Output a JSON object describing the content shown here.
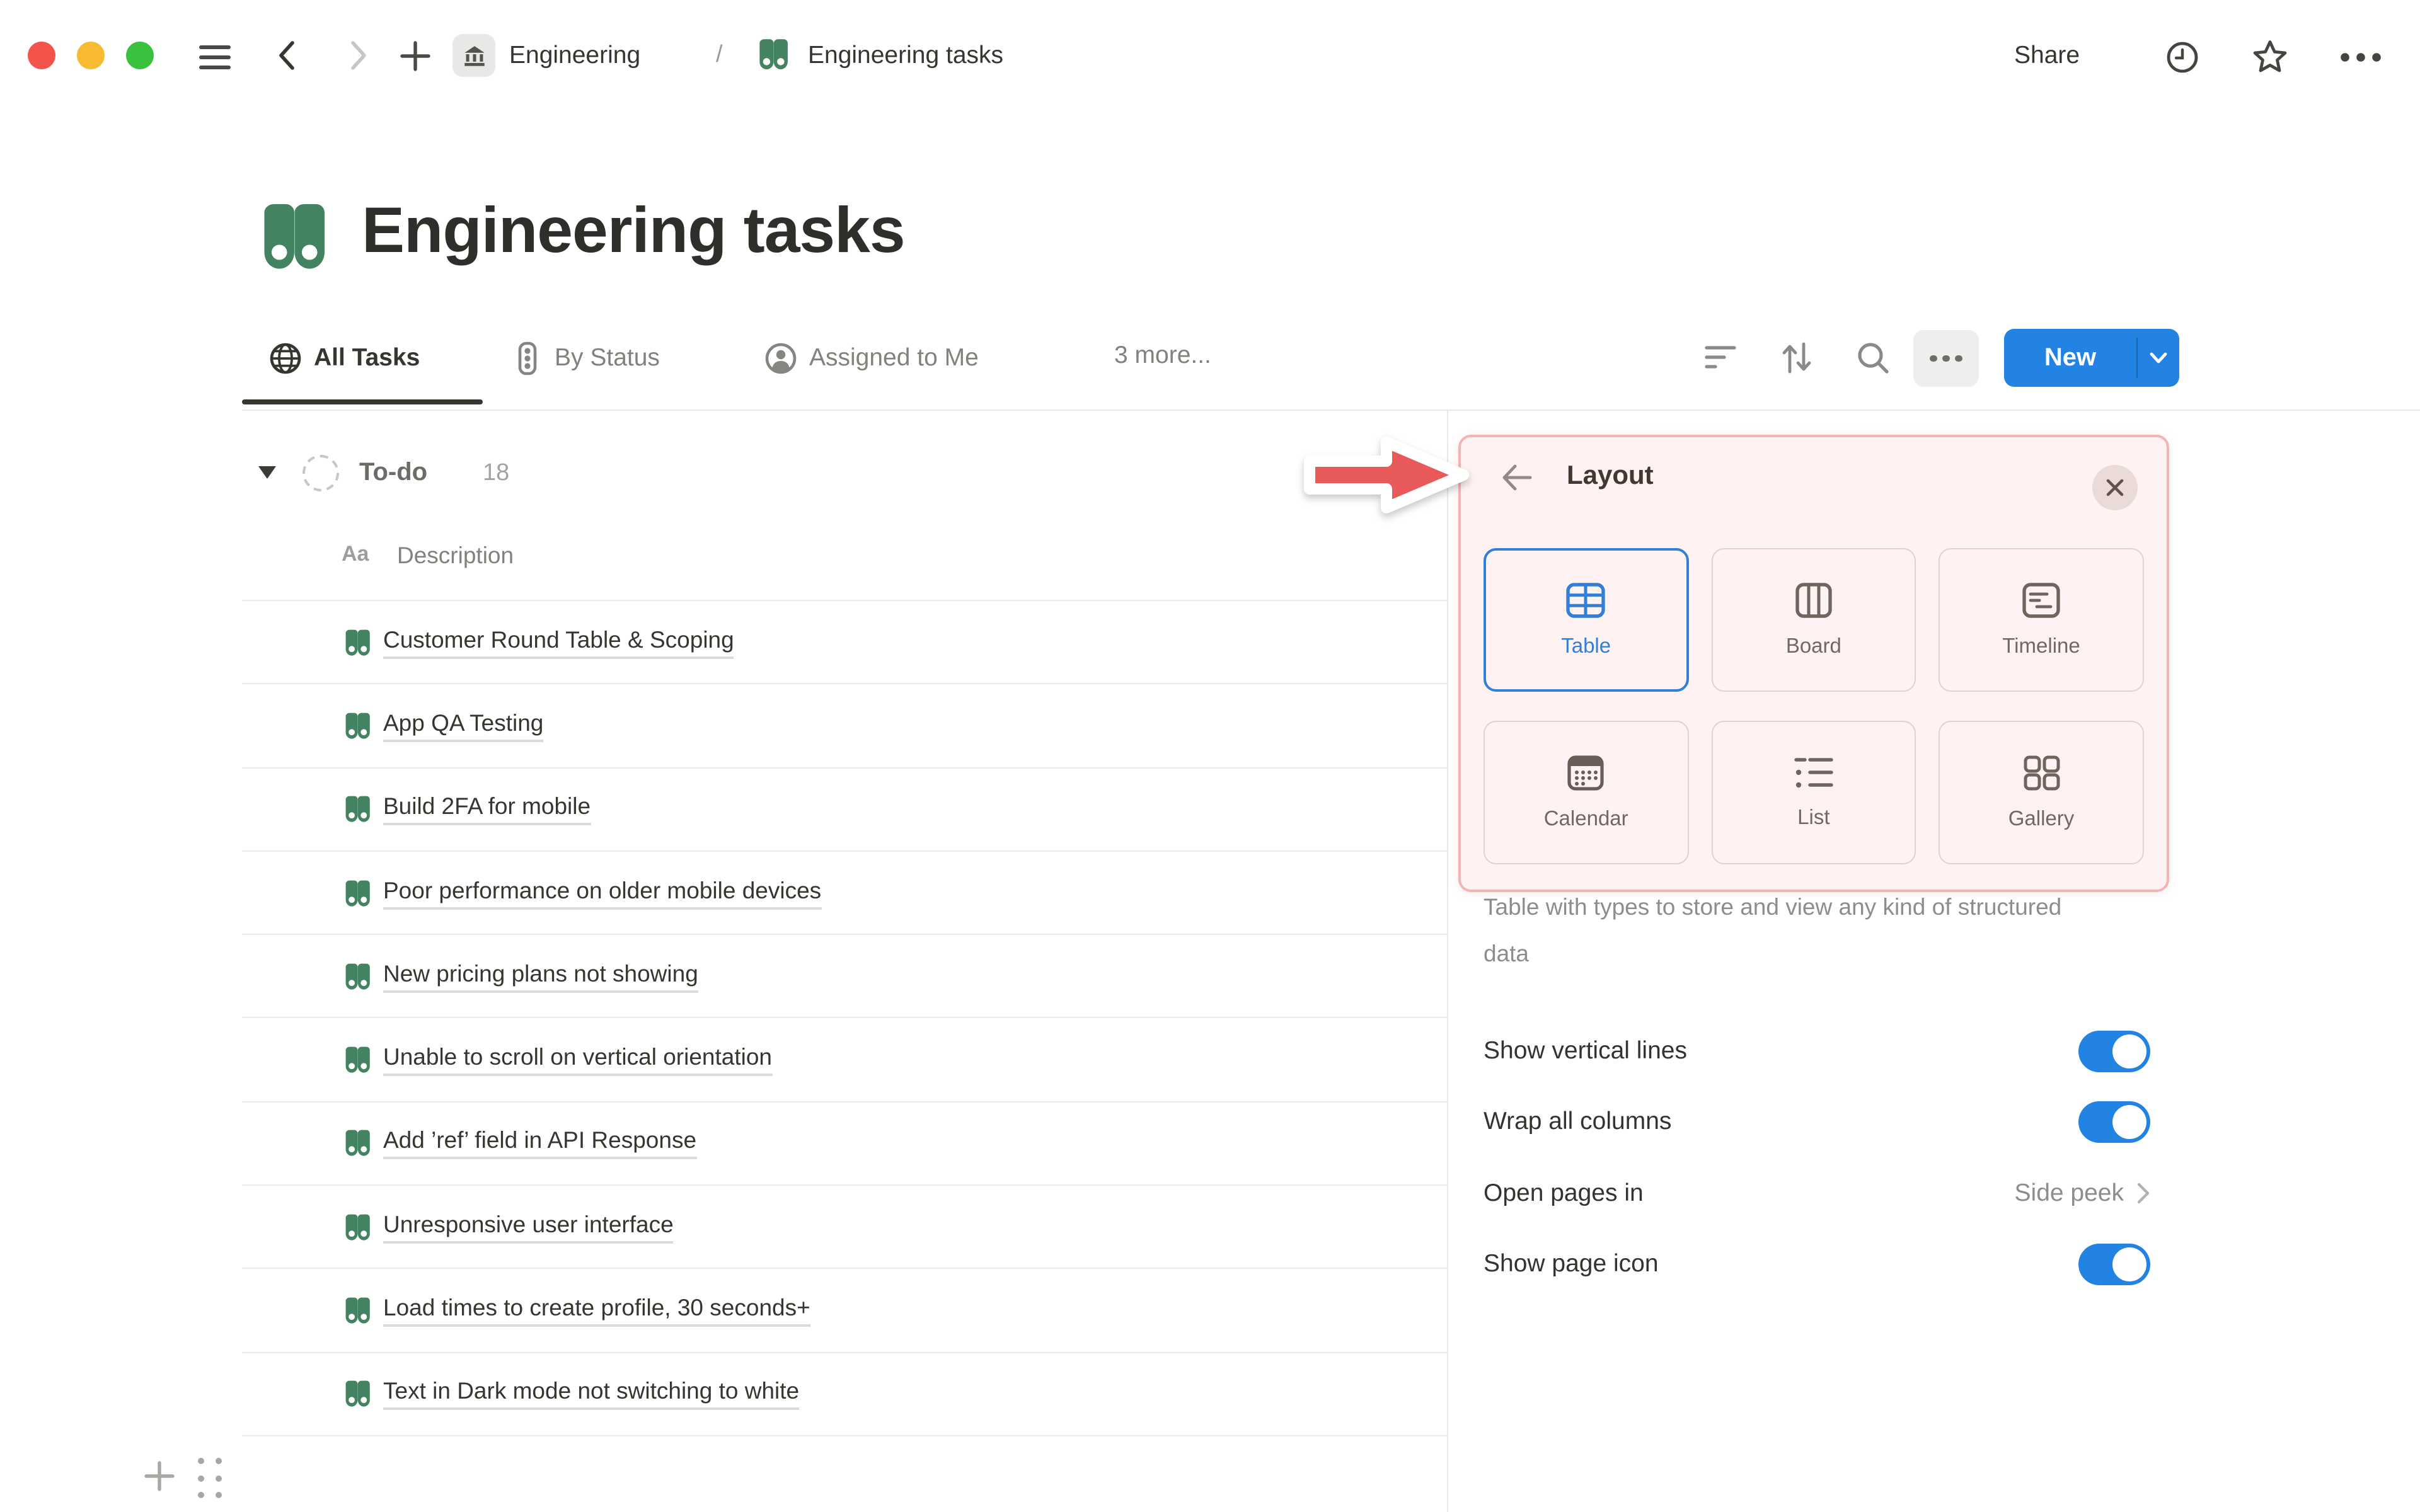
{
  "topbar": {
    "breadcrumb": [
      {
        "icon": "building-icon",
        "label": "Engineering"
      },
      {
        "icon": "binoculars-icon",
        "label": "Engineering tasks"
      }
    ],
    "separator": "/",
    "share_label": "Share"
  },
  "page": {
    "title": "Engineering tasks",
    "icon": "binoculars-icon"
  },
  "tabs": [
    {
      "icon": "globe-icon",
      "label": "All Tasks",
      "active": true
    },
    {
      "icon": "status-icon",
      "label": "By Status",
      "active": false
    },
    {
      "icon": "person-icon",
      "label": "Assigned to Me",
      "active": false
    }
  ],
  "tabs_more": "3 more...",
  "toolbar": {
    "new_label": "New"
  },
  "group": {
    "name": "To-do",
    "count": "18"
  },
  "columns": [
    {
      "icon": "Aa",
      "label": "Description"
    }
  ],
  "tasks": [
    "Customer Round Table & Scoping",
    "App QA Testing",
    "Build 2FA for mobile",
    "Poor performance on older mobile devices",
    "New pricing plans not showing",
    "Unable to scroll on vertical orientation",
    "Add ’ref’ field in API Response",
    "Unresponsive user interface",
    "Load times to create profile, 30 seconds+",
    "Text in Dark mode not switching to white"
  ],
  "panel": {
    "title": "Layout",
    "options": [
      {
        "label": "Table",
        "icon": "table-icon",
        "selected": true
      },
      {
        "label": "Board",
        "icon": "board-icon",
        "selected": false
      },
      {
        "label": "Timeline",
        "icon": "timeline-icon",
        "selected": false
      },
      {
        "label": "Calendar",
        "icon": "calendar-icon",
        "selected": false
      },
      {
        "label": "List",
        "icon": "list-icon",
        "selected": false
      },
      {
        "label": "Gallery",
        "icon": "gallery-icon",
        "selected": false
      }
    ],
    "description": "Table with types to store and view any kind of structured data",
    "settings": [
      {
        "label": "Show vertical lines",
        "type": "toggle",
        "value": "on"
      },
      {
        "label": "Wrap all columns",
        "type": "toggle",
        "value": "on"
      },
      {
        "label": "Open pages in",
        "type": "value",
        "value": "Side peek"
      },
      {
        "label": "Show page icon",
        "type": "toggle",
        "value": "on"
      }
    ]
  },
  "icons": {
    "hamburger": "three-bars",
    "back": "chevron-left",
    "forward": "chevron-right",
    "plus": "plus-glyph",
    "clock": "history-clock",
    "star": "star-outline",
    "ellipsis": "three-dots",
    "filter": "funnel-lines",
    "sort": "up-down-arrows",
    "search": "magnifier",
    "binoculars": "green-double-lens",
    "drag-handle": "six-dots"
  },
  "colors": {
    "accent_blue": "#2383e2",
    "icon_green": "#448361",
    "text_dark": "#37352f",
    "text_gray": "#82817c",
    "divider": "#e9e8e6",
    "annotation_red": "#e85a5a",
    "highlight_pink_border": "rgba(231,96,96,0.42)",
    "traffic_red": "#f4534a",
    "traffic_yellow": "#f8bb31",
    "traffic_green": "#39c13e"
  }
}
